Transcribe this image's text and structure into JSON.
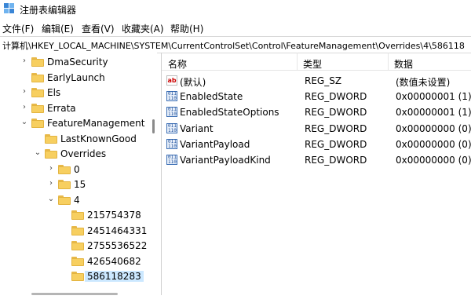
{
  "window": {
    "title": "注册表编辑器"
  },
  "menu": [
    {
      "label": "文件(F)"
    },
    {
      "label": "编辑(E)"
    },
    {
      "label": "查看(V)"
    },
    {
      "label": "收藏夹(A)"
    },
    {
      "label": "帮助(H)"
    }
  ],
  "address": "计算机\\HKEY_LOCAL_MACHINE\\SYSTEM\\CurrentControlSet\\Control\\FeatureManagement\\Overrides\\4\\586118",
  "tree": [
    {
      "label": "DmaSecurity",
      "arrow": "›"
    },
    {
      "label": "EarlyLaunch",
      "arrow": ""
    },
    {
      "label": "Els",
      "arrow": "›"
    },
    {
      "label": "Errata",
      "arrow": "›"
    },
    {
      "label": "FeatureManagement",
      "arrow": "⌄"
    },
    {
      "label": "LastKnownGood",
      "arrow": ""
    },
    {
      "label": "Overrides",
      "arrow": "⌄"
    },
    {
      "label": "0",
      "arrow": "›"
    },
    {
      "label": "15",
      "arrow": "›"
    },
    {
      "label": "4",
      "arrow": "⌄"
    },
    {
      "label": "215754378",
      "arrow": ""
    },
    {
      "label": "2451464331",
      "arrow": ""
    },
    {
      "label": "2755536522",
      "arrow": ""
    },
    {
      "label": "426540682",
      "arrow": ""
    },
    {
      "label": "586118283",
      "arrow": ""
    }
  ],
  "columns": {
    "name": "名称",
    "type": "类型",
    "data": "数据"
  },
  "values": [
    {
      "name": "(默认)",
      "type": "REG_SZ",
      "data": "(数值未设置)",
      "icon": "string-value-icon"
    },
    {
      "name": "EnabledState",
      "type": "REG_DWORD",
      "data": "0x00000001 (1)",
      "icon": "binary-value-icon"
    },
    {
      "name": "EnabledStateOptions",
      "type": "REG_DWORD",
      "data": "0x00000001 (1)",
      "icon": "binary-value-icon"
    },
    {
      "name": "Variant",
      "type": "REG_DWORD",
      "data": "0x00000000 (0)",
      "icon": "binary-value-icon"
    },
    {
      "name": "VariantPayload",
      "type": "REG_DWORD",
      "data": "0x00000000 (0)",
      "icon": "binary-value-icon"
    },
    {
      "name": "VariantPayloadKind",
      "type": "REG_DWORD",
      "data": "0x00000000 (0)",
      "icon": "binary-value-icon"
    }
  ],
  "selected_tree_index": 14,
  "colors": {
    "folder": "#f7cf60",
    "selection": "#cce8ff"
  }
}
